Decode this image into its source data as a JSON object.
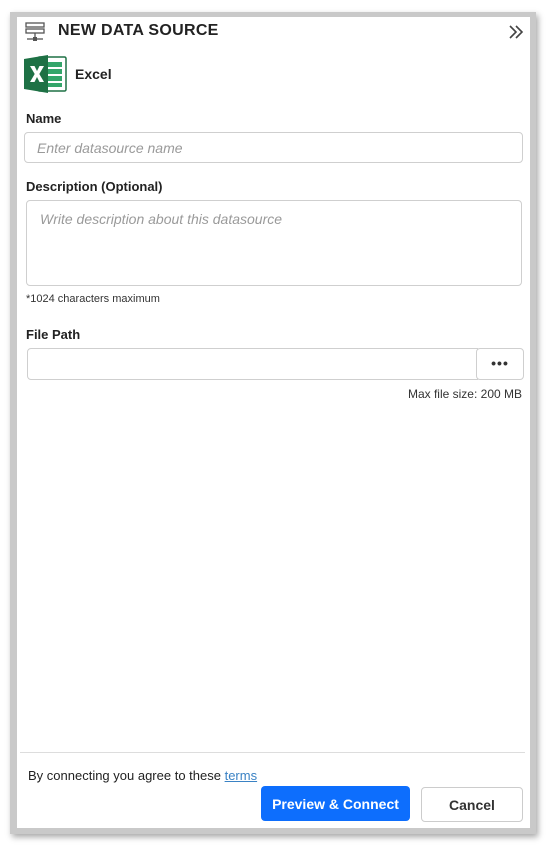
{
  "header": {
    "title": "NEW DATA SOURCE",
    "icon": "datasource-icon",
    "collapse_icon": "double-chevron-right-icon"
  },
  "source": {
    "icon": "excel-icon",
    "label": "Excel",
    "brand_color": "#1e7145"
  },
  "form": {
    "name": {
      "label": "Name",
      "value": "",
      "placeholder": "Enter datasource name"
    },
    "description": {
      "label": "Description (Optional)",
      "value": "",
      "placeholder": "Write description about this datasource",
      "hint": "*1024 characters maximum"
    },
    "file_path": {
      "label": "File Path",
      "value": "",
      "browse_label": "•••",
      "max_size": "Max file size: 200 MB"
    }
  },
  "footer": {
    "terms_prefix": "By connecting you agree to these",
    "terms_link": "terms",
    "primary_button": "Preview & Connect",
    "secondary_button": "Cancel",
    "primary_color": "#0d6efd",
    "link_color": "#3a82c4"
  }
}
